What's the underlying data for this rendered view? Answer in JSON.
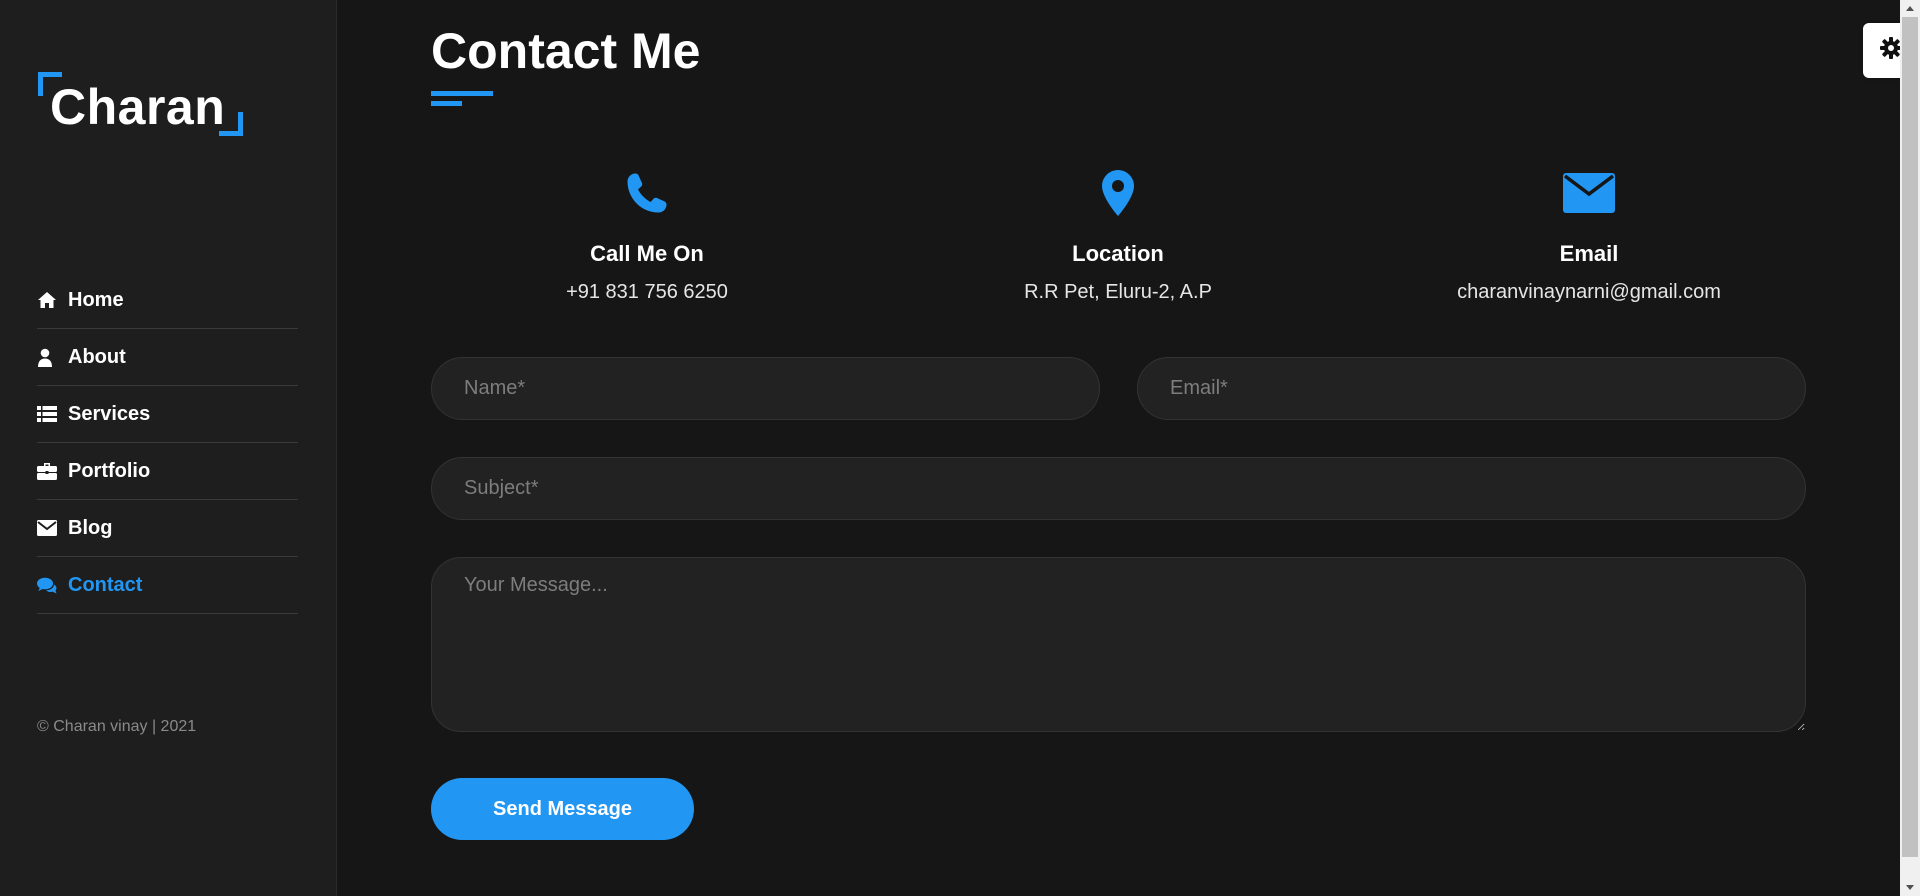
{
  "brand": {
    "name": "Charan",
    "accent": "#2196f3"
  },
  "nav": {
    "items": [
      {
        "label": "Home",
        "icon": "home-icon",
        "active": false
      },
      {
        "label": "About",
        "icon": "user-icon",
        "active": false
      },
      {
        "label": "Services",
        "icon": "list-icon",
        "active": false
      },
      {
        "label": "Portfolio",
        "icon": "briefcase-icon",
        "active": false
      },
      {
        "label": "Blog",
        "icon": "envelope-icon",
        "active": false
      },
      {
        "label": "Contact",
        "icon": "comments-icon",
        "active": true
      }
    ]
  },
  "copyright": "© Charan vinay | 2021",
  "page": {
    "title": "Contact Me"
  },
  "info": [
    {
      "icon": "phone-icon",
      "title": "Call Me On",
      "value": "+91 831 756 6250"
    },
    {
      "icon": "map-marker-icon",
      "title": "Location",
      "value": "R.R Pet, Eluru-2, A.P"
    },
    {
      "icon": "envelope-icon",
      "title": "Email",
      "value": "charanvinaynarni@gmail.com"
    }
  ],
  "form": {
    "name_placeholder": "Name*",
    "email_placeholder": "Email*",
    "subject_placeholder": "Subject*",
    "message_placeholder": "Your Message...",
    "submit_label": "Send Message"
  },
  "settings": {
    "icon": "gear-icon"
  }
}
